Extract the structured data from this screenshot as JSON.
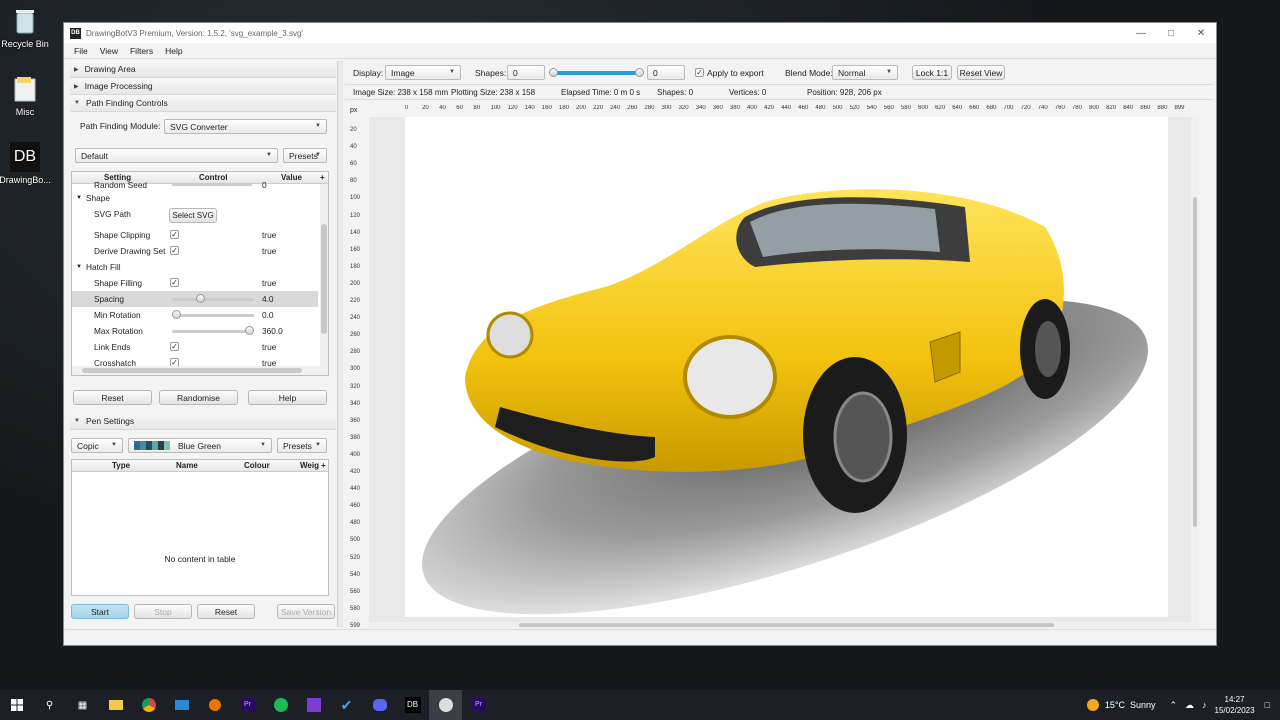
{
  "desktop": {
    "icons": [
      {
        "label": "Recycle Bin",
        "icon": "recycle-bin-icon"
      },
      {
        "label": "Misc",
        "icon": "folder-icon"
      },
      {
        "label": "DrawingBo...",
        "icon": "drawingbot-icon"
      }
    ]
  },
  "window": {
    "title": "DrawingBotV3 Premium, Version: 1.5.2, 'svg_example_3.svg'",
    "app_icon_text": "DB",
    "menu": [
      "File",
      "View",
      "Filters",
      "Help"
    ]
  },
  "left_panel": {
    "sections": {
      "drawing_area": "Drawing Area",
      "image_processing": "Image Processing",
      "path_finding_controls": "Path Finding Controls",
      "pen_settings": "Pen Settings"
    },
    "path_finding_module_label": "Path Finding Module:",
    "path_finding_module_value": "SVG Converter",
    "preset_value": "Default",
    "presets_label": "Presets",
    "settings_table": {
      "headers": [
        "Setting",
        "Control",
        "Value"
      ],
      "add_symbol": "+",
      "random_seed_label": "Random Seed",
      "random_seed_value": "0",
      "group_shape": "Shape",
      "svg_path_label": "SVG Path",
      "select_svg_button": "Select SVG",
      "shape_clipping_label": "Shape Clipping",
      "shape_clipping_value": "true",
      "derive_drawing_set_label": "Derive Drawing Set",
      "derive_drawing_set_value": "true",
      "group_hatch_fill": "Hatch Fill",
      "shape_filling_label": "Shape Filling",
      "shape_filling_value": "true",
      "spacing_label": "Spacing",
      "spacing_value": "4.0",
      "spacing_fraction": 0.33,
      "min_rotation_label": "Min Rotation",
      "min_rotation_value": "0.0",
      "min_rotation_fraction": 0.0,
      "max_rotation_label": "Max Rotation",
      "max_rotation_value": "360.0",
      "max_rotation_fraction": 1.0,
      "link_ends_label": "Link Ends",
      "link_ends_value": "true",
      "crosshatch_label": "Crosshatch",
      "crosshatch_value": "true"
    },
    "buttons": {
      "reset": "Reset",
      "randomise": "Randomise",
      "help": "Help"
    },
    "pen": {
      "mode_value": "Copic",
      "pen_set_value": "Blue Green",
      "presets_label": "Presets",
      "swatch_colors": [
        "#2f6d8c",
        "#3f8ea3",
        "#1f4e6a",
        "#5fa8a0",
        "#2a3d50",
        "#7cc2b4"
      ],
      "headers": [
        "Type",
        "Name",
        "Colour",
        "Weig"
      ],
      "sort_symbol": "+",
      "empty_message": "No content in table"
    },
    "bottom_buttons": {
      "start": "Start",
      "stop": "Stop",
      "reset": "Reset",
      "save_version": "Save Version"
    }
  },
  "viewer": {
    "display_label": "Display:",
    "display_value": "Image",
    "shapes_label": "Shapes:",
    "shapes_from": "0",
    "shapes_to": "0",
    "apply_to_export_label": "Apply to export",
    "blend_mode_label": "Blend Mode:",
    "blend_mode_value": "Normal",
    "lock_button": "Lock 1:1",
    "reset_view_button": "Reset View",
    "info": {
      "image_size": "Image Size: 238 x 158 mm",
      "plotting_size": "Plotting Size: 238 x 158",
      "elapsed_time": "Elapsed Time: 0 m 0 s",
      "shapes": "Shapes: 0",
      "vertices": "Vertices: 0",
      "position": "Position: 928, 206 px"
    },
    "ruler_unit": "px",
    "ruler_top": [
      "0",
      "20",
      "40",
      "60",
      "80",
      "100",
      "120",
      "140",
      "160",
      "180",
      "200",
      "220",
      "240",
      "260",
      "280",
      "300",
      "320",
      "340",
      "360",
      "380",
      "400",
      "420",
      "440",
      "460",
      "480",
      "500",
      "520",
      "540",
      "560",
      "580",
      "600",
      "620",
      "640",
      "660",
      "680",
      "700",
      "720",
      "740",
      "760",
      "780",
      "800",
      "820",
      "840",
      "860",
      "880",
      "899"
    ],
    "ruler_left": [
      "20",
      "40",
      "60",
      "80",
      "100",
      "120",
      "140",
      "160",
      "180",
      "200",
      "220",
      "240",
      "260",
      "280",
      "300",
      "320",
      "340",
      "360",
      "380",
      "400",
      "420",
      "440",
      "460",
      "480",
      "500",
      "520",
      "540",
      "560",
      "580",
      "599"
    ]
  },
  "taskbar": {
    "apps": [
      "start-icon",
      "search-icon",
      "task-view-icon",
      "file-explorer-icon",
      "chrome-icon",
      "mail-icon",
      "blender-icon",
      "premiere-icon",
      "spotify-icon",
      "jetbrains-icon",
      "todo-icon",
      "discord-icon",
      "drawingbot-icon",
      "obs-icon",
      "premiere-icon"
    ],
    "weather": "15°C  Sunny",
    "time": "14:27",
    "date": "15/02/2023"
  }
}
